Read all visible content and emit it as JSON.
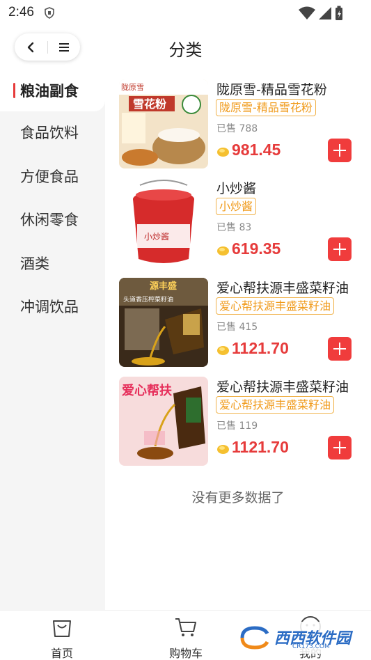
{
  "status": {
    "time": "2:46"
  },
  "header": {
    "title": "分类"
  },
  "sidebar": {
    "items": [
      {
        "label": "粮油副食",
        "active": true
      },
      {
        "label": "食品饮料"
      },
      {
        "label": "方便食品"
      },
      {
        "label": "休闲零食"
      },
      {
        "label": "酒类"
      },
      {
        "label": "冲调饮品"
      }
    ]
  },
  "products": [
    {
      "name": "陇原雪-精品雪花粉",
      "tag": "陇原雪-精品雪花粉",
      "sold": "已售 788",
      "price": "981.45"
    },
    {
      "name": "小炒酱",
      "tag": "小炒酱",
      "sold": "已售 83",
      "price": "619.35"
    },
    {
      "name": "爱心帮扶源丰盛菜籽油",
      "tag": "爱心帮扶源丰盛菜籽油",
      "sold": "已售 415",
      "price": "1121.70"
    },
    {
      "name": "爱心帮扶源丰盛菜籽油",
      "tag": "爱心帮扶源丰盛菜籽油",
      "sold": "已售 119",
      "price": "1121.70"
    }
  ],
  "thumbs": {
    "p0": "雪花粉",
    "p0_brand": "陇原雪",
    "p1": "小炒酱",
    "p2": "源丰盛",
    "p2_sub": "头道香压榨菜籽油",
    "p3": "爱心帮扶"
  },
  "list_footer": "没有更多数据了",
  "tabbar": {
    "items": [
      {
        "label": "首页",
        "icon": "bag-icon"
      },
      {
        "label": "购物车",
        "icon": "cart-icon"
      },
      {
        "label": "我的",
        "icon": "user-icon"
      }
    ]
  },
  "watermark": {
    "text": "西西软件园",
    "sub": "CR173.COM"
  },
  "colors": {
    "accent": "#e63b3b",
    "tag": "#f09a1a",
    "sidebar_bg": "#f5f5f5"
  }
}
